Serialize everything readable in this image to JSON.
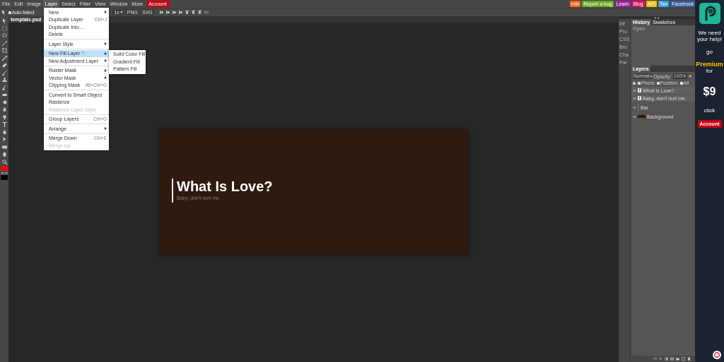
{
  "menubar": {
    "items": [
      {
        "label": "File",
        "selected": false
      },
      {
        "label": "Edit",
        "selected": false
      },
      {
        "label": "Image",
        "selected": false
      },
      {
        "label": "Layer",
        "selected": true
      },
      {
        "label": "Select",
        "selected": false
      },
      {
        "label": "Filter",
        "selected": false
      },
      {
        "label": "View",
        "selected": false
      },
      {
        "label": "Window",
        "selected": false
      },
      {
        "label": "More",
        "selected": false
      }
    ],
    "account_button": "Account",
    "links": [
      {
        "label": "Info",
        "color": "#e8641a"
      },
      {
        "label": "Report a bug",
        "color": "#6aa823"
      },
      {
        "label": "Learn",
        "color": "#a020a0"
      },
      {
        "label": "Blog",
        "color": "#e0106a"
      },
      {
        "label": "API",
        "color": "#e8c000"
      },
      {
        "label": "Twr",
        "color": "#3aa0e0"
      },
      {
        "label": "Facebook",
        "color": "#3b5998"
      }
    ]
  },
  "toolbar": {
    "auto_select": {
      "label": "Auto-Select",
      "checked": false
    },
    "scale": "1x",
    "export_buttons": [
      "PNG",
      "SVG"
    ]
  },
  "document_tabs": [
    {
      "label": "template.psd",
      "selected": true
    }
  ],
  "layer_menu": {
    "items": [
      {
        "kind": "item",
        "label": "New",
        "submenu": true
      },
      {
        "kind": "item",
        "label": "Duplicate Layer",
        "shortcut": "Ctrl+J"
      },
      {
        "kind": "item",
        "label": "Duplicate Into ..."
      },
      {
        "kind": "item",
        "label": "Delete"
      },
      {
        "kind": "separator"
      },
      {
        "kind": "item",
        "label": "Layer Style",
        "submenu": true
      },
      {
        "kind": "separator"
      },
      {
        "kind": "item",
        "label": "New Fill Layer",
        "submenu": true,
        "selected": true
      },
      {
        "kind": "item",
        "label": "New Adjustment Layer",
        "submenu": true
      },
      {
        "kind": "separator"
      },
      {
        "kind": "item",
        "label": "Raster Mask",
        "submenu": true
      },
      {
        "kind": "item",
        "label": "Vector Mask",
        "submenu": true
      },
      {
        "kind": "item",
        "label": "Clipping Mask",
        "shortcut": "Alt+Ctrl+G"
      },
      {
        "kind": "separator"
      },
      {
        "kind": "item",
        "label": "Convert to Smart Object"
      },
      {
        "kind": "item",
        "label": "Rasterize"
      },
      {
        "kind": "item",
        "label": "Rasterize Layer Style",
        "disabled": true
      },
      {
        "kind": "separator"
      },
      {
        "kind": "item",
        "label": "Group Layers",
        "shortcut": "Ctrl+G"
      },
      {
        "kind": "separator"
      },
      {
        "kind": "item",
        "label": "Arrange",
        "submenu": true
      },
      {
        "kind": "separator"
      },
      {
        "kind": "item",
        "label": "Merge Down",
        "shortcut": "Ctrl+E"
      },
      {
        "kind": "item",
        "label": "Merge Up",
        "disabled": true
      }
    ],
    "submenu": [
      "Solid Color Fill",
      "Gradient Fill",
      "Pattern Fill"
    ]
  },
  "canvas": {
    "title": "What Is Love?",
    "subtitle": "Baby, don't hurt me."
  },
  "side_tabs": [
    "Inf",
    "Pro",
    "CSS",
    "Bru",
    "Cha",
    "Par"
  ],
  "history_panel": {
    "tabs": [
      {
        "label": "History",
        "selected": true
      },
      {
        "label": "Swatches",
        "selected": false
      }
    ],
    "items": [
      "Open"
    ]
  },
  "layers_panel": {
    "title": "Layers",
    "blend_mode": "Normal",
    "opacity_label": "Opacity:",
    "opacity": "100%",
    "locks": [
      {
        "label": "Pixels",
        "checked": false
      },
      {
        "label": "Position",
        "checked": false
      },
      {
        "label": "All",
        "checked": false
      }
    ],
    "layers": [
      {
        "name": "What Is Love?",
        "kind": "text",
        "visible": true
      },
      {
        "name": "Baby, don't hurt me.",
        "kind": "text",
        "visible": true
      },
      {
        "name": "Bar",
        "kind": "shape",
        "visible": true
      },
      {
        "name": "Background",
        "kind": "fill",
        "visible": true
      }
    ]
  },
  "ad": {
    "lines": [
      {
        "text": "We need your help!",
        "kind": "plain"
      },
      {
        "text": "go",
        "kind": "plain"
      },
      {
        "text": "Premium",
        "kind": "accent"
      },
      {
        "text": "for",
        "kind": "plain"
      },
      {
        "text": "$9",
        "kind": "big"
      },
      {
        "text": "click",
        "kind": "plain"
      }
    ],
    "button": "Account"
  }
}
